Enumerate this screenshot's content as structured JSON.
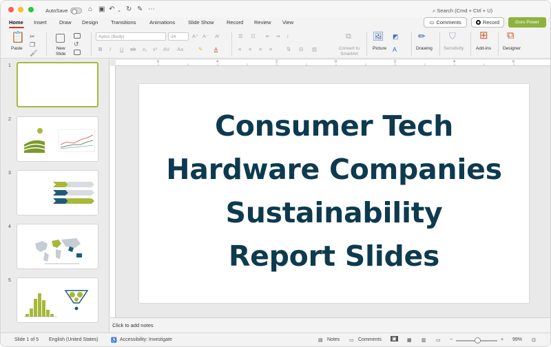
{
  "titlebar": {
    "autosave_label": "AutoSave",
    "search_placeholder": "Search (Cmd + Ctrl + U)"
  },
  "tabs": [
    "Home",
    "Insert",
    "Draw",
    "Design",
    "Transitions",
    "Animations",
    "Slide Show",
    "Record",
    "Review",
    "View"
  ],
  "active_tab": "Home",
  "header_buttons": {
    "comments": "Comments",
    "record": "Record",
    "guru": "Guru Power"
  },
  "ribbon": {
    "paste": "Paste",
    "new_slide_line1": "New",
    "new_slide_line2": "Slide",
    "font_name": "Aptos (Body)",
    "font_size": "24",
    "convert_line1": "Convert to",
    "convert_line2": "SmartArt",
    "picture": "Picture",
    "drawing": "Drawing",
    "sensitivity": "Sensitivity",
    "addins": "Add-ins",
    "designer": "Designer"
  },
  "thumbnails": [
    {
      "number": "1"
    },
    {
      "number": "2"
    },
    {
      "number": "3"
    },
    {
      "number": "4"
    },
    {
      "number": "5"
    }
  ],
  "ruler_numbers": [
    "6",
    "5",
    "4",
    "3",
    "2",
    "1",
    "0",
    "1",
    "2",
    "3",
    "4",
    "5",
    "6"
  ],
  "slide": {
    "title_lines": [
      "Consumer Tech",
      "Hardware Companies",
      "Sustainability",
      "Report Slides"
    ]
  },
  "notes_placeholder": "Click to add notes",
  "statusbar": {
    "slide_info": "Slide 1 of 5",
    "language": "English (United States)",
    "accessibility": "Accessibility: Investigate",
    "notes": "Notes",
    "comments": "Comments",
    "zoom": "99%"
  },
  "colors": {
    "title_text": "#0e3a4f",
    "accent_green": "#a7b83a",
    "guru_button": "#8db33e",
    "tab_underline": "#c43e1c"
  }
}
